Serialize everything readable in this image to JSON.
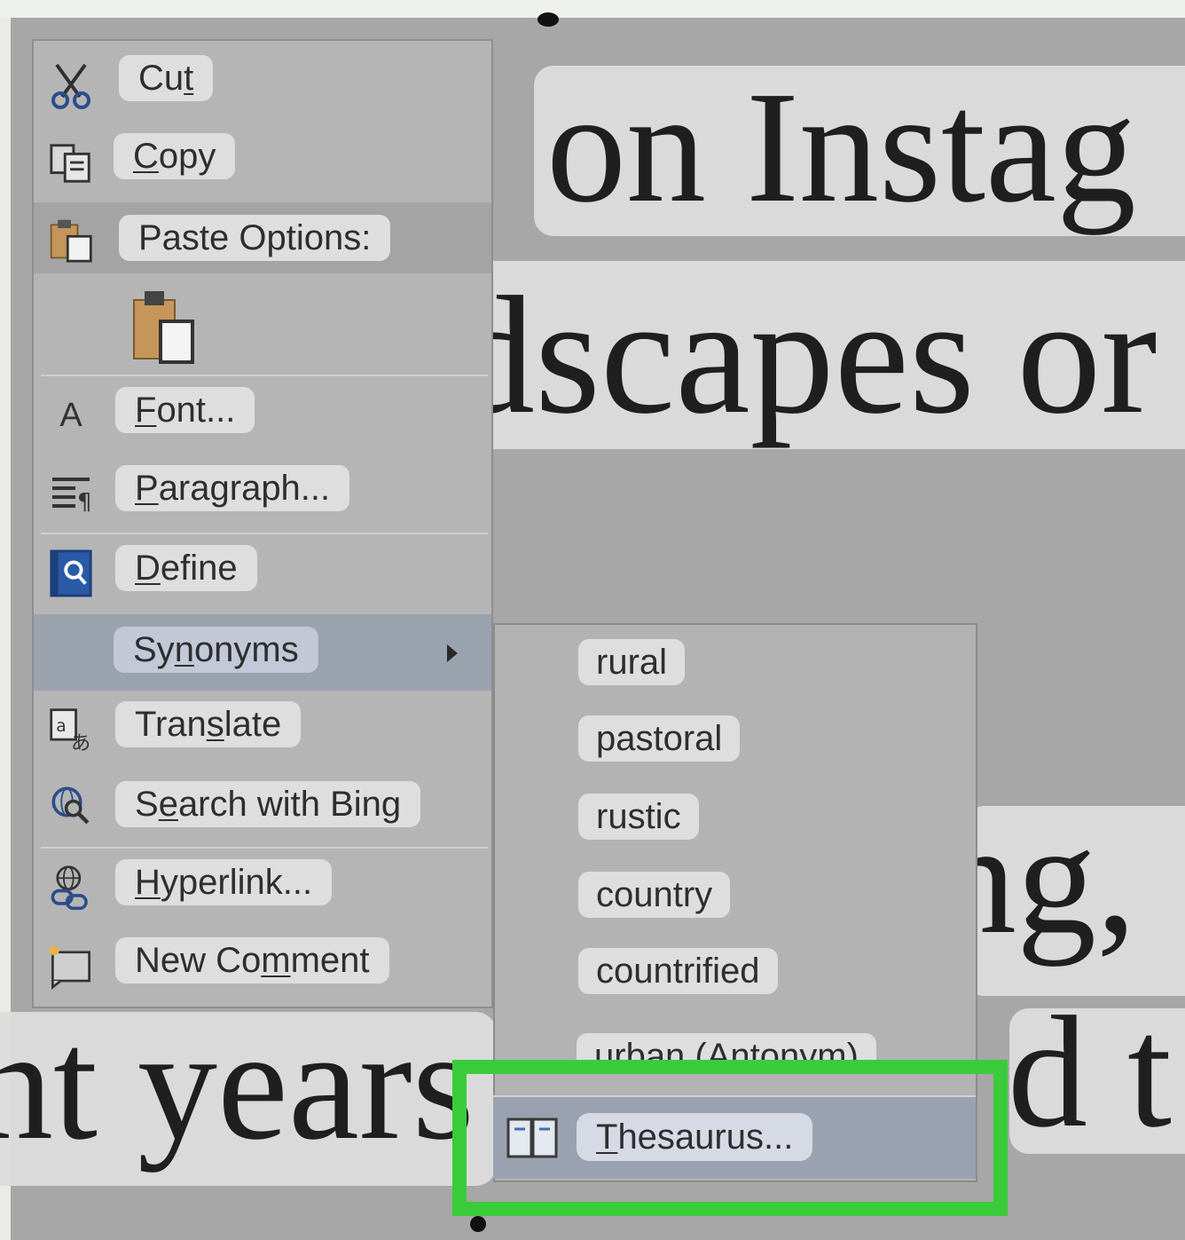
{
  "document": {
    "line1": "on Instag",
    "line2": "dscapes or",
    "line3": "ng, ",
    "line4_left": "nt years",
    "line4_right": "d t"
  },
  "context_menu": {
    "items": [
      {
        "label": "Cut",
        "icon": "scissors-icon"
      },
      {
        "label": "Copy",
        "icon": "copy-icon"
      },
      {
        "label": "Paste Options:",
        "icon": "paste-icon"
      },
      {
        "label": "",
        "icon": "paste-keep-text-icon"
      },
      {
        "label": "Font...",
        "icon": "font-icon"
      },
      {
        "label": "Paragraph...",
        "icon": "paragraph-icon"
      },
      {
        "label": "Define",
        "icon": "define-icon"
      },
      {
        "label": "Synonyms",
        "icon": ""
      },
      {
        "label": "Translate",
        "icon": "translate-icon"
      },
      {
        "label": "Search with Bing",
        "icon": "search-icon"
      },
      {
        "label": "Hyperlink...",
        "icon": "hyperlink-icon"
      },
      {
        "label": "New Comment",
        "icon": "comment-icon"
      }
    ]
  },
  "synonyms_submenu": {
    "items": [
      "rural",
      "pastoral",
      "rustic",
      "country",
      "countrified",
      "urban (Antonym)"
    ],
    "thesaurus": "Thesaurus..."
  },
  "highlight_color": "#3acb3a"
}
